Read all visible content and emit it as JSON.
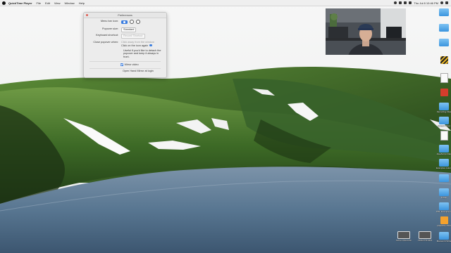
{
  "menubar": {
    "app_name": "QuickTime Player",
    "menus": [
      "File",
      "Edit",
      "View",
      "Window",
      "Help"
    ],
    "clock": "Thu Jul 8 10:46 PM"
  },
  "prefs": {
    "title": "Preferences",
    "menu_bar_icon_label": "Menu bar icon:",
    "popover_size_label": "Popover size:",
    "popover_size_value": "Standard",
    "keyboard_shortcut_label": "Keyboard shortcut:",
    "keyboard_shortcut_placeholder": "Record Shortcut",
    "close_popover_label": "Close popover when:",
    "close_option_1": "Click away from the window",
    "close_option_2": "Click on the icon again",
    "help_text": "Useful if you'd like to detach the popover and keep it always in front.",
    "mirror_video_label": "Mirror video",
    "mirror_video_checked": true,
    "open_at_login_label": "Open Hand Mirror at login"
  },
  "webcam": {
    "description_name": "webcam-overlay"
  },
  "desktop_icons": [
    {
      "name": "desktop-item-1",
      "label": "",
      "kind": "folder"
    },
    {
      "name": "desktop-item-2",
      "label": "",
      "kind": "folder"
    },
    {
      "name": "desktop-item-3",
      "label": "",
      "kind": "folder"
    },
    {
      "name": "desktop-item-4",
      "label": "",
      "kind": "stripe"
    },
    {
      "name": "desktop-item-5",
      "label": "",
      "kind": "doc"
    },
    {
      "name": "desktop-item-6",
      "label": "",
      "kind": "red"
    },
    {
      "name": "desktop-item-7",
      "label": "Recording Files",
      "kind": "folder"
    },
    {
      "name": "desktop-item-8",
      "label": "Sample Video",
      "kind": "folder"
    },
    {
      "name": "desktop-item-9",
      "label": "",
      "kind": "doc"
    },
    {
      "name": "desktop-item-10",
      "label": "JavaScript Files",
      "kind": "folder"
    },
    {
      "name": "desktop-item-11",
      "label": "Examples Automator",
      "kind": "folder"
    },
    {
      "name": "desktop-item-12",
      "label": "",
      "kind": "folder"
    },
    {
      "name": "desktop-item-13",
      "label": "Folder",
      "kind": "folder"
    },
    {
      "name": "desktop-item-14",
      "label": "PDF Example Folder",
      "kind": "folder"
    },
    {
      "name": "desktop-item-15",
      "label": "AGENDA 2021",
      "kind": "orange"
    },
    {
      "name": "desktop-item-16",
      "label": "Macworld Write",
      "kind": "folder"
    }
  ],
  "bottom_files": [
    {
      "name": "screen-recording-file",
      "label": "Screen Recording 2021-0...PM.mov"
    },
    {
      "name": "mp4-file",
      "label": "P1010779.MP4"
    }
  ],
  "colors": {
    "accent": "#3a7de0",
    "sky": "#f4f4f4",
    "hills": "#3f6b2a",
    "lake": "#6b8aa6"
  }
}
